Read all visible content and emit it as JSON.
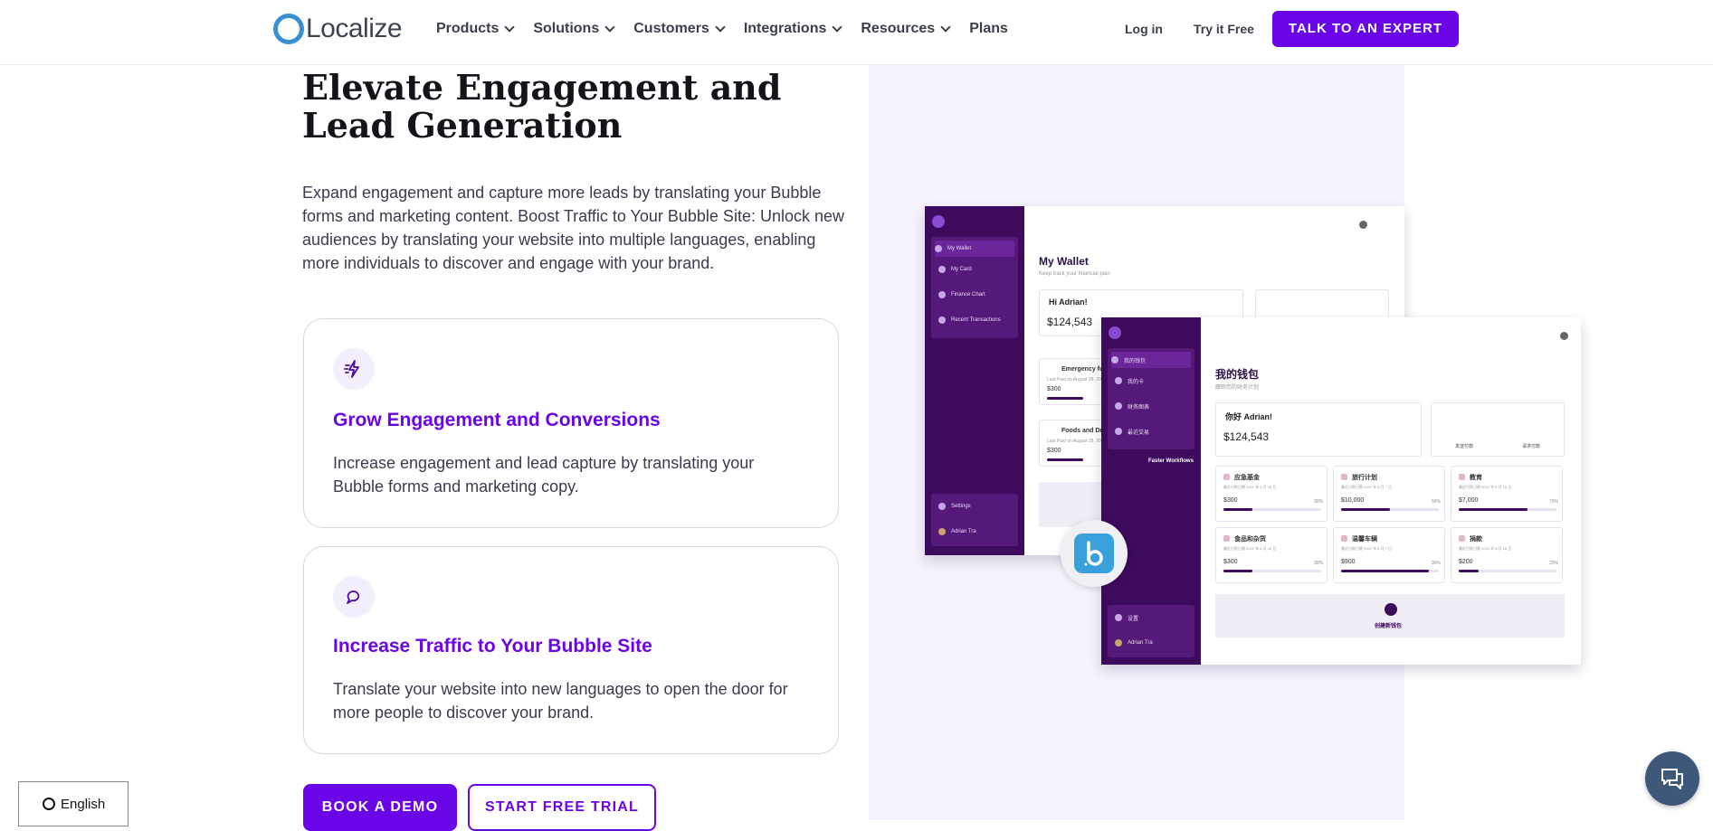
{
  "nav": {
    "logo_text": "Localize",
    "menu": [
      {
        "label": "Products",
        "dropdown": true
      },
      {
        "label": "Solutions",
        "dropdown": true
      },
      {
        "label": "Customers",
        "dropdown": true
      },
      {
        "label": "Integrations",
        "dropdown": true
      },
      {
        "label": "Resources",
        "dropdown": true
      },
      {
        "label": "Plans",
        "dropdown": false
      }
    ],
    "login": "Log in",
    "try_free": "Try it Free",
    "cta": "TALK TO AN EXPERT"
  },
  "hero": {
    "title": "Elevate Engagement and Lead Generation",
    "lead": "Expand engagement and capture more leads by translating your Bubble forms and marketing content. Boost Traffic to Your Bubble Site: Unlock new audiences by translating your website into multiple languages, enabling more individuals to discover and engage with your brand."
  },
  "cards": [
    {
      "icon": "lightning-icon",
      "title": "Grow Engagement and Conversions",
      "text": "Increase engagement and lead capture by translating your Bubble forms and marketing copy."
    },
    {
      "icon": "chat-bubble-icon",
      "title": "Increase Traffic to Your Bubble Site",
      "text": "Translate your website into new languages to open the door for more people to discover your brand."
    }
  ],
  "buttons": {
    "book_demo": "BOOK A DEMO",
    "free_trial": "START FREE TRIAL"
  },
  "language_selector": "English",
  "mockup": {
    "back": {
      "sidebar": [
        "My Wallet",
        "My Card",
        "Finance Chart",
        "Recent Transactions"
      ],
      "settings": "Settings",
      "user": "Adrian Tra",
      "title": "My Wallet",
      "subtitle": "Keep track your financial plan",
      "greeting": "Hi Adrian!",
      "balance": "$124,543",
      "items": [
        {
          "label": "Emergency fu",
          "sub": "Last Paid on August 28, 20",
          "amount": "$300"
        },
        {
          "label": "Foods and Dri",
          "sub": "Last Paid on August 28, 20",
          "amount": "$300"
        }
      ]
    },
    "front": {
      "sidebar": [
        "我的钱包",
        "我的卡",
        "财务图表",
        "最近交易"
      ],
      "settings": "设置",
      "user": "Adrian Tra",
      "title": "我的钱包",
      "subtitle": "跟踪您的财务计划",
      "greeting": "你好 Adrian!",
      "balance": "$124,543",
      "action1": "发送付款",
      "action2": "请求付款",
      "workflow_label": "Faster Workflows",
      "create": "创建新钱包",
      "tiles": [
        {
          "label": "应急基金",
          "sub": "最近付款日期 2022 年 8 月 28 日",
          "amount": "$300",
          "pct": "30%",
          "fill": 0.3
        },
        {
          "label": "旅行计划",
          "sub": "最近付款日期 2022 年 8 月 7 日",
          "amount": "$10,000",
          "pct": "50%",
          "fill": 0.5
        },
        {
          "label": "教育",
          "sub": "最近付款日期 2022 年 8 月 16 日",
          "amount": "$7,000",
          "pct": "70%",
          "fill": 0.7
        },
        {
          "label": "食品和杂货",
          "sub": "最近付款日期 2022 年 8 月 28 日",
          "amount": "$300",
          "pct": "30%",
          "fill": 0.3
        },
        {
          "label": "温馨车辆",
          "sub": "最近付款日期 2022 年 8 月 7 日",
          "amount": "$900",
          "pct": "90%",
          "fill": 0.9
        },
        {
          "label": "捐款",
          "sub": "最近付款日期 2022 年 8 月 28 日",
          "amount": "$200",
          "pct": "20%",
          "fill": 0.2
        }
      ]
    }
  },
  "colors": {
    "accent": "#6a05e8",
    "panel_bg": "#f5f3fc",
    "sidebar_dark": "#3d0a5e",
    "bubble_blue": "#3aa0dc"
  }
}
